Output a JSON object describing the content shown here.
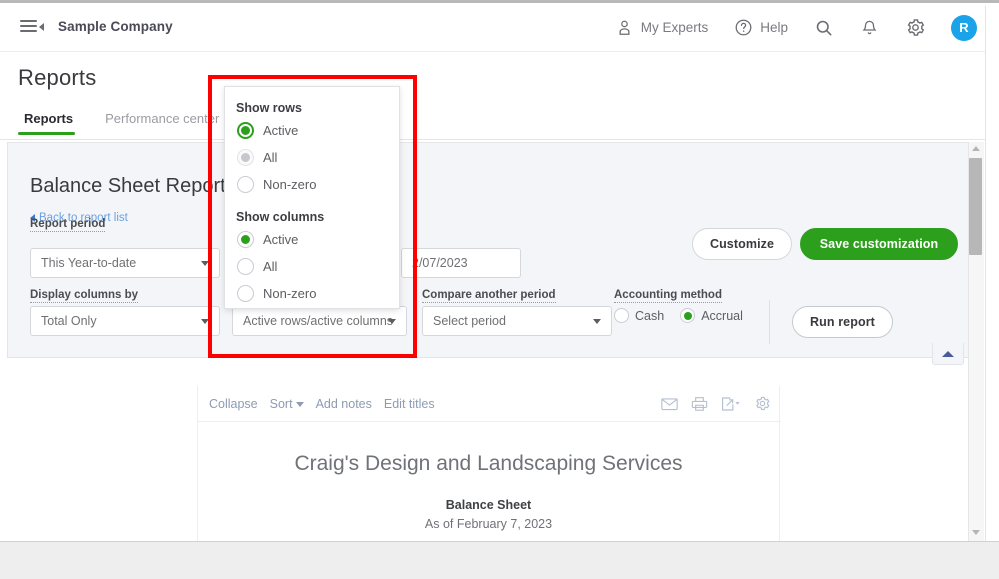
{
  "header": {
    "menu_icon": "hamburger-collapse-icon",
    "company": "Sample Company",
    "my_experts": "My Experts",
    "help": "Help",
    "search_icon": "search-icon",
    "notifications_icon": "bell-icon",
    "settings_icon": "gear-icon",
    "avatar_initial": "R"
  },
  "page": {
    "title": "Reports",
    "tabs": [
      {
        "label": "Reports",
        "active": true
      },
      {
        "label": "Performance center",
        "active": false
      }
    ]
  },
  "report_controls": {
    "title": "Balance Sheet Report",
    "back_link": "Back to report list",
    "back_chevron_icon": "chevron-left-icon",
    "labels": {
      "report_period": "Report period",
      "display_columns_by": "Display columns by",
      "compare_another_period": "Compare another period",
      "accounting_method": "Accounting method"
    },
    "report_period_value": "This Year-to-date",
    "date_value": "2/07/2023",
    "display_columns_value": "Total Only",
    "rows_cols_value": "Active rows/active columns",
    "compare_period_value": "Select period",
    "accounting_method": {
      "options": [
        {
          "label": "Cash",
          "selected": false
        },
        {
          "label": "Accrual",
          "selected": true
        }
      ]
    },
    "buttons": {
      "customize": "Customize",
      "save_customization": "Save customization",
      "run_report": "Run report"
    },
    "collapse_chevron_icon": "chevron-up-icon"
  },
  "rows_cols_popover": {
    "show_rows": {
      "heading": "Show rows",
      "options": [
        {
          "label": "Active",
          "state": "selected-focused"
        },
        {
          "label": "All",
          "state": "disabled"
        },
        {
          "label": "Non-zero",
          "state": "unselected"
        }
      ]
    },
    "show_columns": {
      "heading": "Show columns",
      "options": [
        {
          "label": "Active",
          "state": "selected"
        },
        {
          "label": "All",
          "state": "unselected"
        },
        {
          "label": "Non-zero",
          "state": "unselected"
        }
      ]
    }
  },
  "report_body": {
    "toolbar": {
      "collapse": "Collapse",
      "sort": "Sort",
      "add_notes": "Add notes",
      "edit_titles": "Edit titles",
      "email_icon": "envelope-icon",
      "print_icon": "printer-icon",
      "export_icon": "export-icon",
      "gear_icon": "gear-icon"
    },
    "company_name": "Craig's Design and Landscaping Services",
    "report_name": "Balance Sheet",
    "as_of": "As of February 7, 2023"
  },
  "scrollbar": {
    "up_arrow_icon": "scroll-up-arrow-icon",
    "down_arrow_icon": "scroll-down-arrow-icon",
    "thumb": "scroll-thumb"
  },
  "colors": {
    "accent_green": "#2ca01c",
    "link_blue": "#6aa0e0",
    "avatar_blue": "#1aa3e8",
    "highlight_red": "#ff0000"
  }
}
